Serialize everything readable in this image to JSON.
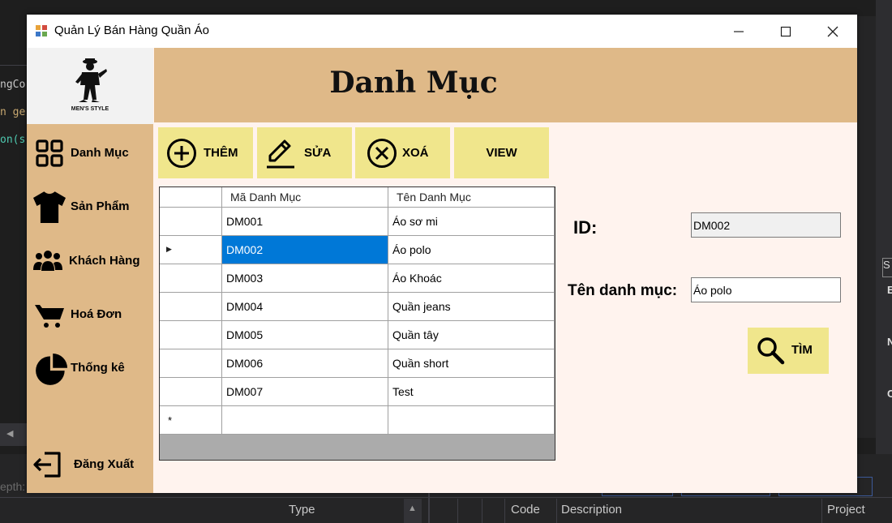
{
  "ide": {
    "code_lines": [
      {
        "text": "ngCo",
        "color": "#c8c8c8"
      },
      {
        "text": "n ge",
        "color": "#c8a870"
      },
      {
        "text": "on(s",
        "color": "#4ec9b0"
      }
    ],
    "depth_label": "epth:",
    "columns": {
      "type": "Type",
      "code": "Code",
      "description": "Description",
      "project": "Project"
    },
    "side_letters": [
      "S",
      "E",
      "N",
      "C"
    ]
  },
  "window": {
    "title": "Quản Lý Bán Hàng Quần Áo",
    "logo_text": "MEN'S STYLE",
    "header_title": "Danh Mục"
  },
  "sidebar": {
    "items": [
      {
        "label": "Danh Mục",
        "icon": "grid-icon"
      },
      {
        "label": "Sản Phẩm",
        "icon": "tshirt-icon"
      },
      {
        "label": "Khách Hàng",
        "icon": "users-icon"
      },
      {
        "label": "Hoá Đơn",
        "icon": "cart-icon"
      },
      {
        "label": "Thống kê",
        "icon": "pie-chart-icon"
      }
    ],
    "logout_label": "Đăng Xuất"
  },
  "toolbar": {
    "add_label": "THÊM",
    "edit_label": "SỬA",
    "delete_label": "XOÁ",
    "view_label": "VIEW"
  },
  "grid": {
    "columns": [
      "Mã Danh Mục",
      "Tên Danh Mục"
    ],
    "rows": [
      [
        "DM001",
        "Áo sơ mi"
      ],
      [
        "DM002",
        "Áo polo"
      ],
      [
        "DM003",
        "Áo Khoác"
      ],
      [
        "DM004",
        "Quần jeans"
      ],
      [
        "DM005",
        "Quần tây"
      ],
      [
        "DM006",
        "Quần short"
      ],
      [
        "DM007",
        "Test"
      ]
    ],
    "selected_index": 1,
    "new_row_marker": "*"
  },
  "form": {
    "id_label": "ID:",
    "id_value": "DM002",
    "name_label": "Tên danh mục:",
    "name_value": "Áo polo",
    "search_label": "TÌM"
  },
  "colors": {
    "sidebar": "#dfb988",
    "button": "#f0e68c",
    "selection": "#0078d7",
    "content_bg": "#fff3ee"
  }
}
